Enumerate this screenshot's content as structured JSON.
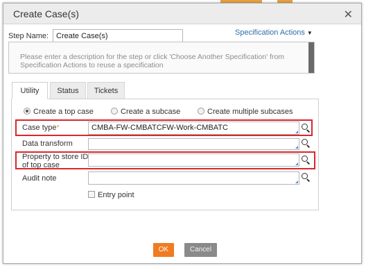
{
  "dialog": {
    "title": "Create Case(s)"
  },
  "step": {
    "label": "Step Name:",
    "value": "Create Case(s)"
  },
  "spec_actions": {
    "label": "Specification Actions"
  },
  "description": {
    "placeholder": "Please enter a description for the step or click 'Choose Another Specification' from Specification Actions to reuse a specification"
  },
  "tabs": [
    {
      "label": "Utility"
    },
    {
      "label": "Status"
    },
    {
      "label": "Tickets"
    }
  ],
  "radios": [
    {
      "label": "Create a top case",
      "selected": true
    },
    {
      "label": "Create a subcase",
      "selected": false
    },
    {
      "label": "Create multiple subcases",
      "selected": false
    }
  ],
  "fields": {
    "case_type": {
      "label": "Case type",
      "required_mark": "*",
      "value": "CMBA-FW-CMBATCFW-Work-CMBATC"
    },
    "data_transform": {
      "label": "Data transform",
      "value": ""
    },
    "property": {
      "label_line1": "Property to store ID",
      "label_line2": "of top case",
      "value": ""
    },
    "audit_note": {
      "label": "Audit note",
      "value": ""
    }
  },
  "entry_point": {
    "label": "Entry point",
    "checked": false
  },
  "buttons": {
    "ok": "OK",
    "cancel": "Cancel"
  },
  "colors": {
    "accent_ok": "#f07b21",
    "highlight_box": "#d9272e",
    "link": "#2e6da4",
    "required": "#e8a040"
  }
}
